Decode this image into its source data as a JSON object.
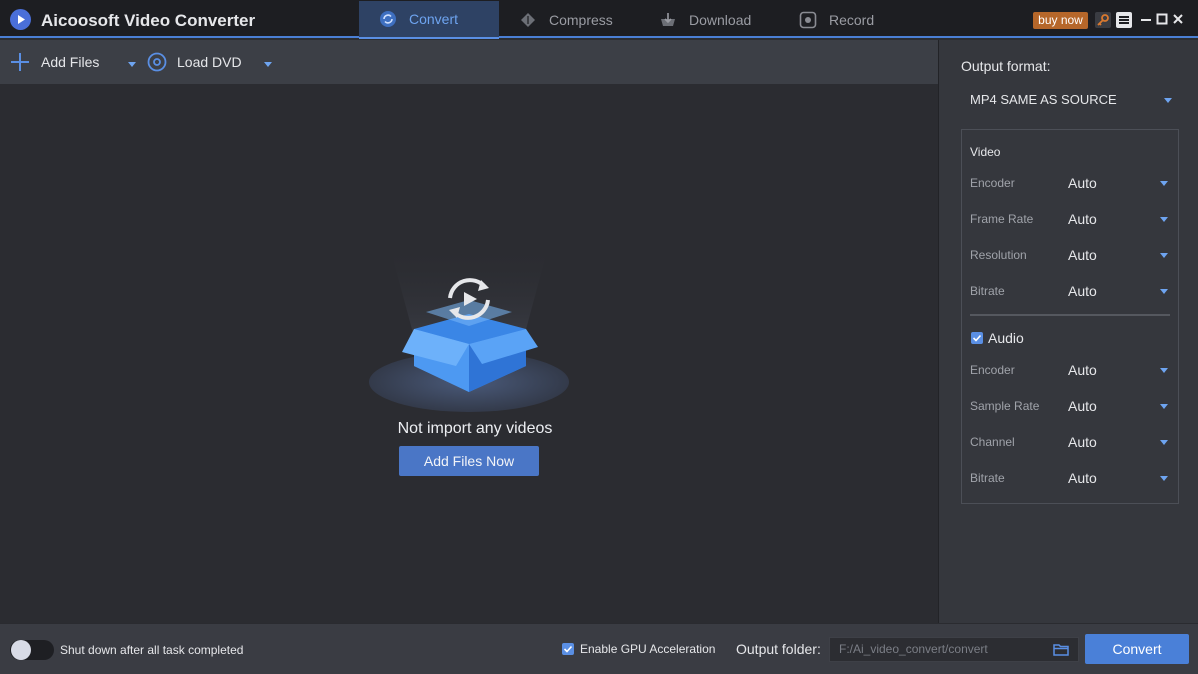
{
  "app": {
    "title": "Aicoosoft Video Converter"
  },
  "tabs": [
    {
      "label": "Convert",
      "icon": "convert-icon",
      "active": true
    },
    {
      "label": "Compress",
      "icon": "compress-icon",
      "active": false
    },
    {
      "label": "Download",
      "icon": "download-icon",
      "active": false
    },
    {
      "label": "Record",
      "icon": "record-icon",
      "active": false
    }
  ],
  "window": {
    "buy_label": "buy now"
  },
  "toolbar": {
    "add_files": "Add Files",
    "load_dvd": "Load DVD"
  },
  "main": {
    "empty_text": "Not import any videos",
    "add_now": "Add Files Now"
  },
  "panel": {
    "output_format_label": "Output format:",
    "output_format_value": "MP4 SAME AS SOURCE",
    "video": {
      "title": "Video",
      "rows": [
        {
          "label": "Encoder",
          "value": "Auto"
        },
        {
          "label": "Frame Rate",
          "value": "Auto"
        },
        {
          "label": "Resolution",
          "value": "Auto"
        },
        {
          "label": "Bitrate",
          "value": "Auto"
        }
      ]
    },
    "audio": {
      "title": "Audio",
      "checked": true,
      "rows": [
        {
          "label": "Encoder",
          "value": "Auto"
        },
        {
          "label": "Sample Rate",
          "value": "Auto"
        },
        {
          "label": "Channel",
          "value": "Auto"
        },
        {
          "label": "Bitrate",
          "value": "Auto"
        }
      ]
    }
  },
  "bottom": {
    "shutdown_label": "Shut down after all task completed",
    "shutdown_on": false,
    "gpu_label": "Enable GPU Acceleration",
    "gpu_checked": true,
    "output_folder_label": "Output folder:",
    "output_folder_value": "F:/Ai_video_convert/convert",
    "convert_label": "Convert"
  },
  "colors": {
    "accent": "#4a80d8",
    "buy": "#b6672a",
    "active_tab": "#6ea4f0"
  }
}
